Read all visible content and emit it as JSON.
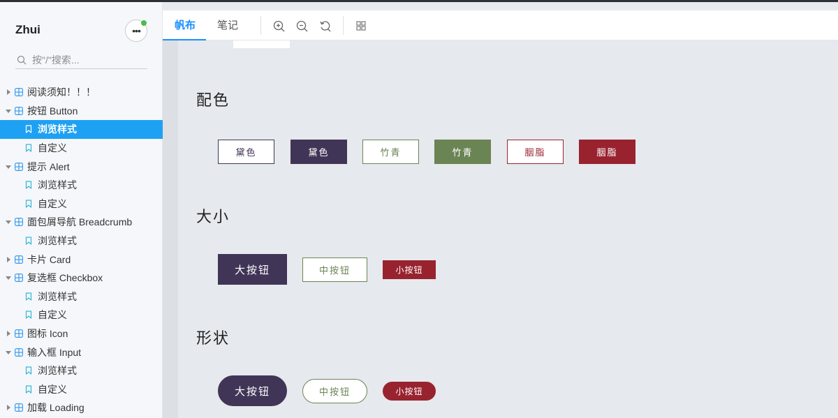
{
  "sidebar": {
    "brand": "Zhui",
    "more_label": "•••",
    "search_placeholder": "按\"/\"搜索...",
    "tree": [
      {
        "label": "阅读须知！！！",
        "level": 0,
        "expanded": false
      },
      {
        "label": "按钮 Button",
        "level": 0,
        "expanded": true
      },
      {
        "label": "浏览样式",
        "level": 1,
        "active": true
      },
      {
        "label": "自定义",
        "level": 1
      },
      {
        "label": "提示 Alert",
        "level": 0,
        "expanded": true
      },
      {
        "label": "浏览样式",
        "level": 1
      },
      {
        "label": "自定义",
        "level": 1
      },
      {
        "label": "面包屑导航 Breadcrumb",
        "level": 0,
        "expanded": true
      },
      {
        "label": "浏览样式",
        "level": 1
      },
      {
        "label": "卡片 Card",
        "level": 0,
        "expanded": false
      },
      {
        "label": "复选框 Checkbox",
        "level": 0,
        "expanded": true
      },
      {
        "label": "浏览样式",
        "level": 1
      },
      {
        "label": "自定义",
        "level": 1
      },
      {
        "label": "图标 Icon",
        "level": 0,
        "expanded": false
      },
      {
        "label": "输入框 Input",
        "level": 0,
        "expanded": true
      },
      {
        "label": "浏览样式",
        "level": 1
      },
      {
        "label": "自定义",
        "level": 1
      },
      {
        "label": "加载 Loading",
        "level": 0,
        "expanded": false
      }
    ]
  },
  "toolbar": {
    "tabs": [
      {
        "label": "帆布",
        "active": true
      },
      {
        "label": "笔记",
        "active": false
      }
    ],
    "icons": [
      "zoom-in-icon",
      "zoom-out-icon",
      "reset-zoom-icon",
      "grid-icon"
    ]
  },
  "content": {
    "sections": {
      "color": {
        "title": "配色",
        "buttons": [
          "黛色",
          "黛色",
          "竹青",
          "竹青",
          "胭脂",
          "胭脂"
        ]
      },
      "size": {
        "title": "大小",
        "buttons": [
          "大按钮",
          "中按钮",
          "小按钮"
        ]
      },
      "shape": {
        "title": "形状",
        "buttons": [
          "大按钮",
          "中按钮",
          "小按钮"
        ]
      }
    }
  },
  "colors": {
    "accent": "#1ea1f2",
    "dai": "#413557",
    "zhuqing": "#6b8454",
    "yanzhi": "#98232f"
  }
}
